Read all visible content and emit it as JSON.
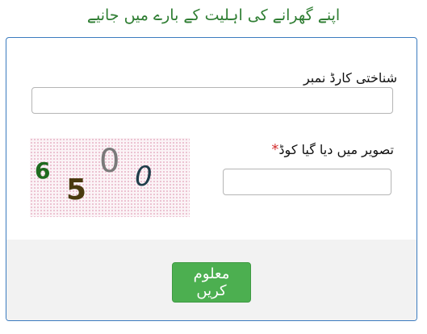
{
  "page": {
    "title": "اپنے گھرانے کی اہلیت کے بارے میں جانیے"
  },
  "form": {
    "cnic_label": "شناختی کارڈ نمبر",
    "cnic_value": "",
    "code_label": "تصویر میں دیا گیا کوڈ",
    "required_mark": "*",
    "code_value": "",
    "submit_label": "معلوم کریں"
  },
  "captcha": {
    "digits": [
      "6",
      "5",
      "0",
      "0"
    ]
  },
  "colors": {
    "title": "#2e7d32",
    "panel_border": "#3b7bbf",
    "button": "#4caf50",
    "required": "#d32f2f"
  }
}
